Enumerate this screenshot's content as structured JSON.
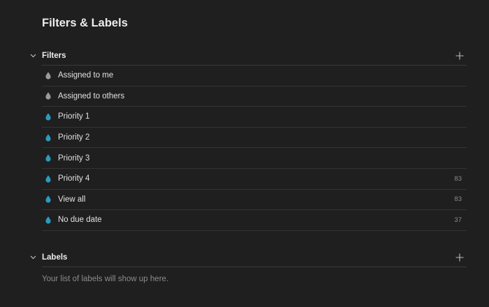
{
  "page": {
    "title": "Filters & Labels"
  },
  "filters": {
    "title": "Filters",
    "items": [
      {
        "label": "Assigned to me",
        "count": "",
        "color": "#9a9a9a"
      },
      {
        "label": "Assigned to others",
        "count": "",
        "color": "#9a9a9a"
      },
      {
        "label": "Priority 1",
        "count": "",
        "color": "#2a9bbf"
      },
      {
        "label": "Priority 2",
        "count": "",
        "color": "#2a9bbf"
      },
      {
        "label": "Priority 3",
        "count": "",
        "color": "#2a9bbf"
      },
      {
        "label": "Priority 4",
        "count": "83",
        "color": "#2a9bbf"
      },
      {
        "label": "View all",
        "count": "83",
        "color": "#2a9bbf"
      },
      {
        "label": "No due date",
        "count": "37",
        "color": "#2a9bbf"
      }
    ]
  },
  "labels": {
    "title": "Labels",
    "empty_message": "Your list of labels will show up here."
  },
  "colors": {
    "background": "#1f1f1f",
    "filter_gray": "#9a9a9a",
    "filter_blue": "#2a9bbf",
    "divider": "#333333"
  },
  "icons": {
    "collapse": "chevron-down-icon",
    "add": "plus-icon",
    "filter": "droplet-icon"
  }
}
